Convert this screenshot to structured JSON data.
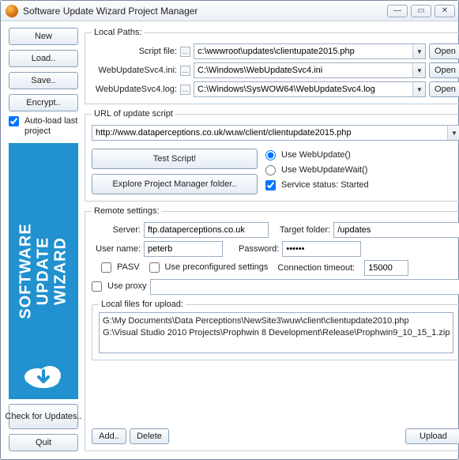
{
  "window": {
    "title": "Software Update Wizard Project Manager"
  },
  "left": {
    "new": "New",
    "load": "Load..",
    "save": "Save..",
    "encrypt": "Encrypt..",
    "autoload": "Auto-load last project",
    "check": "Check for Updates..",
    "quit": "Quit",
    "banner_line1": "SOFTWARE",
    "banner_line2": "UPDATE",
    "banner_line3": "WIZARD"
  },
  "paths": {
    "legend": "Local Paths:",
    "script_label": "Script file:",
    "script_value": "c:\\wwwroot\\updates\\clientupate2015.php",
    "ini_label": "WebUpdateSvc4.ini:",
    "ini_value": "C:\\Windows\\WebUpdateSvc4.ini",
    "log_label": "WebUpdateSvc4.log:",
    "log_value": "C:\\Windows\\SysWOW64\\WebUpdateSvc4.log",
    "open": "Open"
  },
  "url": {
    "legend": "URL of update script",
    "value": "http://www.dataperceptions.co.uk/wuw/client/clientupdate2015.php",
    "test": "Test Script!",
    "explore": "Explore Project Manager folder..",
    "use_wu": "Use WebUpdate()",
    "use_wuw": "Use WebUpdateWait()",
    "service_status": "Service status: Started"
  },
  "remote": {
    "legend": "Remote settings:",
    "server_label": "Server:",
    "server_value": "ftp.dataperceptions.co.uk",
    "target_label": "Target folder:",
    "target_value": "/updates",
    "user_label": "User name:",
    "user_value": "peterb",
    "pass_label": "Password:",
    "pass_value": "••••••",
    "pasv": "PASV",
    "preconf": "Use preconfigured settings",
    "timeout_label": "Connection timeout:",
    "timeout_value": "15000",
    "proxy": "Use proxy",
    "files_legend": "Local files for upload:",
    "file1": "G:\\My Documents\\Data Perceptions\\NewSite3\\wuw\\client\\clientupdate2010.php",
    "file2": "G:\\Visual Studio 2010 Projects\\Prophwin 8 Development\\Release\\Prophwin9_10_15_1.zip",
    "add": "Add..",
    "delete": "Delete",
    "upload": "Upload"
  }
}
